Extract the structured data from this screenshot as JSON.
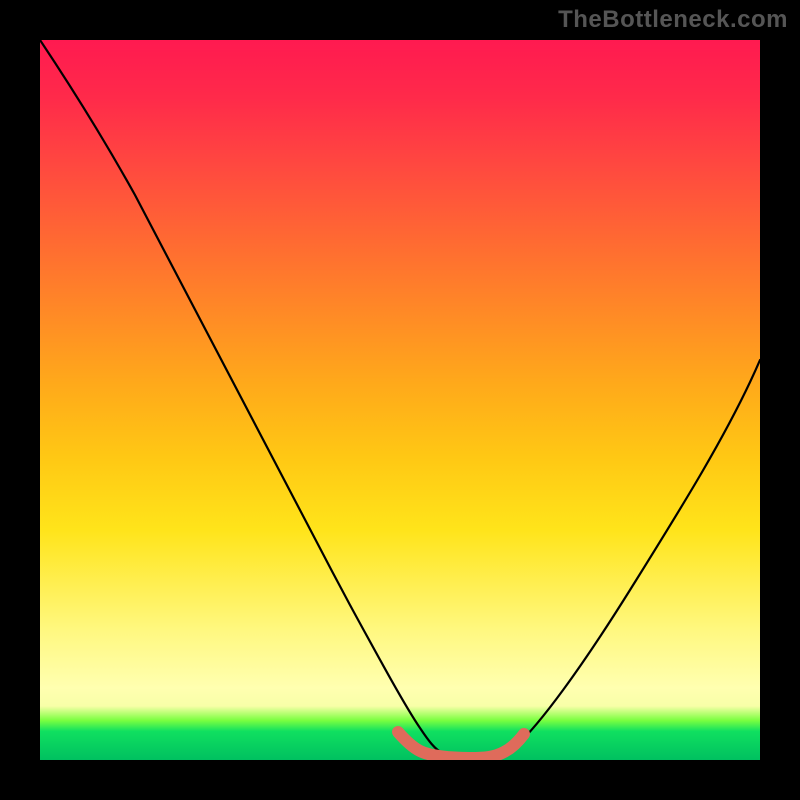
{
  "watermark": "TheBottleneck.com",
  "chart_data": {
    "type": "line",
    "title": "",
    "xlabel": "",
    "ylabel": "",
    "xlim": [
      0,
      100
    ],
    "ylim": [
      0,
      100
    ],
    "legend": false,
    "grid": false,
    "background": "red-orange-yellow-green vertical gradient",
    "series": [
      {
        "name": "main-curve",
        "color": "#000000",
        "x": [
          0,
          5,
          10,
          15,
          20,
          25,
          30,
          35,
          40,
          45,
          48,
          50,
          52,
          55,
          58,
          60,
          62,
          65,
          70,
          75,
          80,
          85,
          90,
          95,
          100
        ],
        "y": [
          100,
          90,
          80,
          70,
          60,
          50,
          40,
          30,
          20,
          10,
          4,
          2,
          0.5,
          0,
          0,
          0.5,
          2,
          5,
          13,
          22,
          32,
          42,
          52,
          56,
          58
        ]
      },
      {
        "name": "flat-bottom-marker",
        "color": "#e06a5a",
        "x": [
          48,
          50,
          52,
          54,
          56,
          58,
          60,
          62,
          64
        ],
        "y": [
          2.5,
          1.5,
          0.8,
          0.5,
          0.5,
          0.5,
          0.8,
          1.5,
          2.5
        ]
      }
    ],
    "annotations": []
  }
}
